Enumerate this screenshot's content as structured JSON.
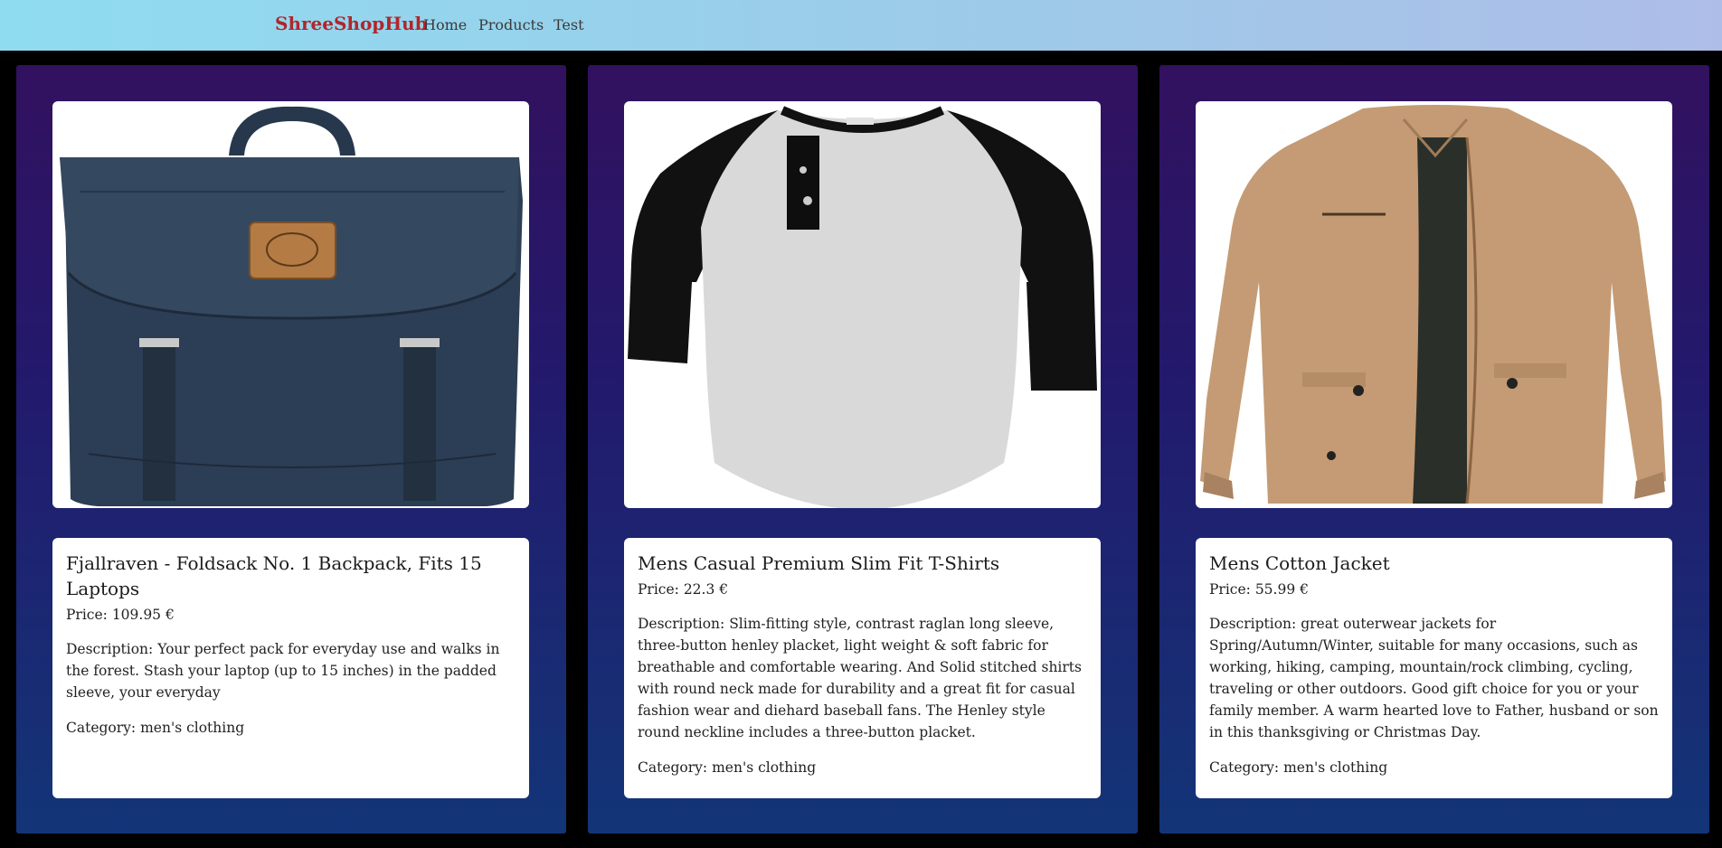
{
  "nav": {
    "brand": "ShreeShopHub",
    "links": [
      "Home",
      "Products",
      "Test"
    ]
  },
  "products": [
    {
      "image_icon": "backpack-image",
      "title": "Fjallraven - Foldsack No. 1 Backpack, Fits 15 Laptops",
      "price_label": "Price:",
      "price": "109.95 €",
      "description_label": "Description:",
      "description": "Your perfect pack for everyday use and walks in the forest. Stash your laptop (up to 15 inches) in the padded sleeve, your everyday",
      "category_label": "Category:",
      "category": "men's clothing"
    },
    {
      "image_icon": "tshirt-image",
      "title": "Mens Casual Premium Slim Fit T-Shirts",
      "price_label": "Price:",
      "price": "22.3 €",
      "description_label": "Description:",
      "description": "Slim-fitting style, contrast raglan long sleeve, three-button henley placket, light weight & soft fabric for breathable and comfortable wearing. And Solid stitched shirts with round neck made for durability and a great fit for casual fashion wear and diehard baseball fans. The Henley style round neckline includes a three-button placket.",
      "category_label": "Category:",
      "category": "men's clothing"
    },
    {
      "image_icon": "jacket-image",
      "title": "Mens Cotton Jacket",
      "price_label": "Price:",
      "price": "55.99 €",
      "description_label": "Description:",
      "description": "great outerwear jackets for Spring/Autumn/Winter, suitable for many occasions, such as working, hiking, camping, mountain/rock climbing, cycling, traveling or other outdoors. Good gift choice for you or your family member. A warm hearted love to Father, husband or son in this thanksgiving or Christmas Day.",
      "category_label": "Category:",
      "category": "men's clothing"
    }
  ],
  "colors": {
    "brand": "#b1262b",
    "card_top": "#32115f",
    "card_bottom": "#133578"
  }
}
